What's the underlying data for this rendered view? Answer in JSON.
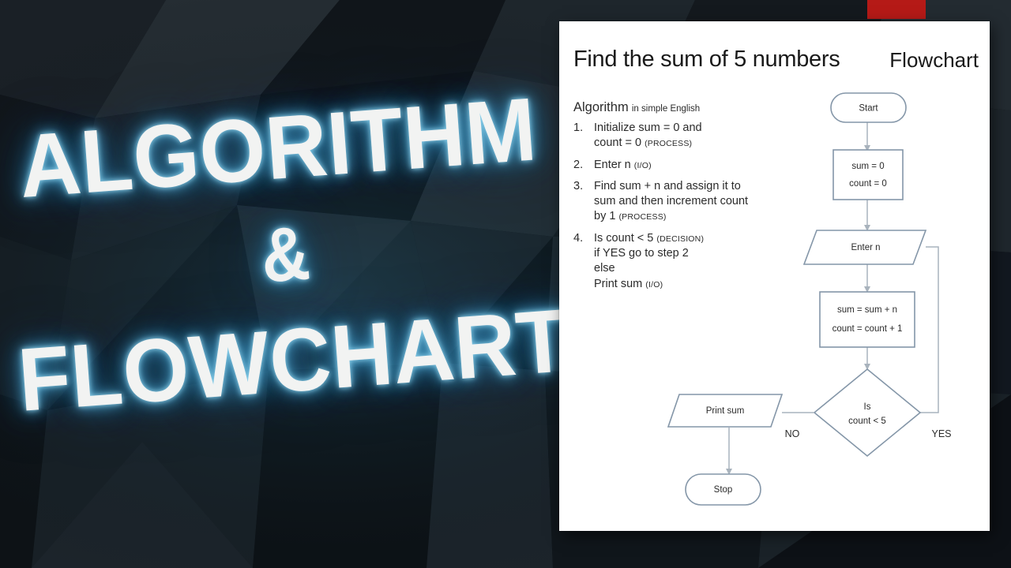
{
  "background": {
    "style": "low-poly-dark",
    "base_color": "#0d1114",
    "accent_color": "#1d3b49"
  },
  "accent_block": {
    "name": "red-accent-block",
    "color": "#b51a17"
  },
  "title": {
    "line1": "ALGORITHM",
    "line2": "&",
    "line3": "FLOWCHART",
    "text_color": "#f2f3f2",
    "glow_color": "#5ab4dc"
  },
  "slide": {
    "title": "Find the sum of 5 numbers",
    "kicker": "Flowchart",
    "background": "#ffffff",
    "algorithm": {
      "heading_main": "Algorithm",
      "heading_sub": "in simple English",
      "steps": [
        {
          "num": "1.",
          "line1": "Initialize sum = 0 and",
          "line2": "count = 0",
          "tag": "(PROCESS)"
        },
        {
          "num": "2.",
          "line1": "Enter n",
          "line2": "",
          "tag": "(I/O)"
        },
        {
          "num": "3.",
          "line1": "Find sum + n and assign it to",
          "line2": "sum and then increment count",
          "line3": "by 1",
          "tag": "(PROCESS)"
        },
        {
          "num": "4.",
          "line1": "Is count < 5",
          "tag": "(DECISION)",
          "line2": "if YES go to step 2",
          "line3": "else",
          "line4": "Print sum",
          "tag2": "(I/O)"
        }
      ]
    },
    "flowchart": {
      "shape_stroke": "#8496a8",
      "connector_stroke": "#a9b3bd",
      "nodes": [
        {
          "id": "start",
          "shape": "terminator",
          "text": "Start"
        },
        {
          "id": "init",
          "shape": "process",
          "text_line1": "sum = 0",
          "text_line2": "count = 0"
        },
        {
          "id": "input",
          "shape": "io",
          "text": "Enter n"
        },
        {
          "id": "accum",
          "shape": "process",
          "text_line1": "sum = sum + n",
          "text_line2": "count = count + 1"
        },
        {
          "id": "decision",
          "shape": "decision",
          "text_line1": "Is",
          "text_line2": "count < 5"
        },
        {
          "id": "print",
          "shape": "io",
          "text": "Print sum"
        },
        {
          "id": "stop",
          "shape": "terminator",
          "text": "Stop"
        }
      ],
      "edge_labels": {
        "no": "NO",
        "yes": "YES"
      }
    }
  }
}
